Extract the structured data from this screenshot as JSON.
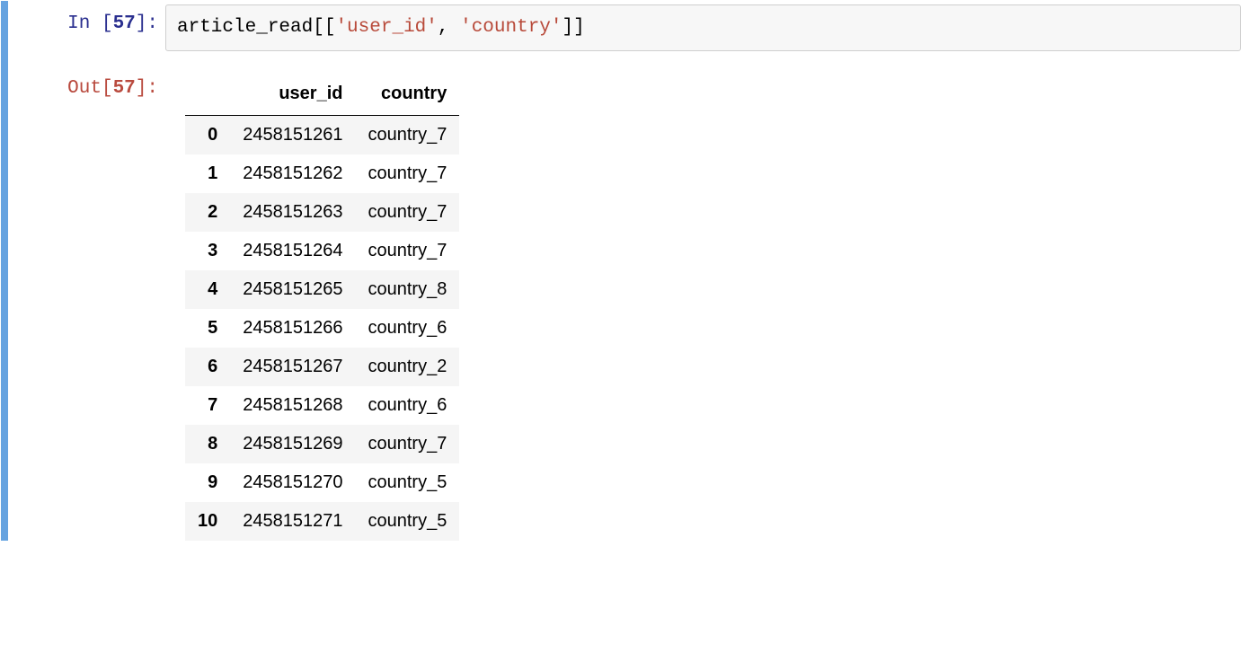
{
  "exec_count": "57",
  "in_label_prefix": "In [",
  "in_label_suffix": "]:",
  "out_label_prefix": "Out[",
  "out_label_suffix": "]:",
  "code": {
    "var": "article_read",
    "open": "[[",
    "lit1": "'user_id'",
    "comma": ", ",
    "lit2": "'country'",
    "close": "]]"
  },
  "table": {
    "columns": [
      "user_id",
      "country"
    ],
    "rows": [
      {
        "idx": "0",
        "user_id": "2458151261",
        "country": "country_7"
      },
      {
        "idx": "1",
        "user_id": "2458151262",
        "country": "country_7"
      },
      {
        "idx": "2",
        "user_id": "2458151263",
        "country": "country_7"
      },
      {
        "idx": "3",
        "user_id": "2458151264",
        "country": "country_7"
      },
      {
        "idx": "4",
        "user_id": "2458151265",
        "country": "country_8"
      },
      {
        "idx": "5",
        "user_id": "2458151266",
        "country": "country_6"
      },
      {
        "idx": "6",
        "user_id": "2458151267",
        "country": "country_2"
      },
      {
        "idx": "7",
        "user_id": "2458151268",
        "country": "country_6"
      },
      {
        "idx": "8",
        "user_id": "2458151269",
        "country": "country_7"
      },
      {
        "idx": "9",
        "user_id": "2458151270",
        "country": "country_5"
      },
      {
        "idx": "10",
        "user_id": "2458151271",
        "country": "country_5"
      }
    ]
  }
}
